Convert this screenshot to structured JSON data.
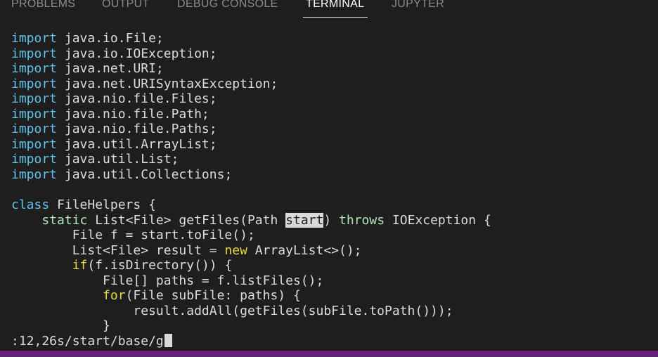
{
  "panel": {
    "tabs": [
      {
        "label": "PROBLEMS"
      },
      {
        "label": "OUTPUT"
      },
      {
        "label": "DEBUG CONSOLE"
      },
      {
        "label": "TERMINAL"
      },
      {
        "label": "JUPYTER"
      }
    ],
    "active_tab": "TERMINAL"
  },
  "editor": {
    "imports": [
      {
        "keyword": "import",
        "rest": " java.io.File;"
      },
      {
        "keyword": "import",
        "rest": " java.io.IOException;"
      },
      {
        "keyword": "import",
        "rest": " java.net.URI;"
      },
      {
        "keyword": "import",
        "rest": " java.net.URISyntaxException;"
      },
      {
        "keyword": "import",
        "rest": " java.nio.file.Files;"
      },
      {
        "keyword": "import",
        "rest": " java.nio.file.Path;"
      },
      {
        "keyword": "import",
        "rest": " java.nio.file.Paths;"
      },
      {
        "keyword": "import",
        "rest": " java.util.ArrayList;"
      },
      {
        "keyword": "import",
        "rest": " java.util.List;"
      },
      {
        "keyword": "import",
        "rest": " java.util.Collections;"
      }
    ],
    "class_line": {
      "keyword": "class",
      "rest": " FileHelpers {"
    },
    "method_line": {
      "indent": "    ",
      "keyword": "static",
      "before_match": " List<File> getFiles(Path ",
      "match": "start",
      "after_match": ") ",
      "throws": "throws",
      "end": " IOException {"
    },
    "line_file_f": "        File f = start.toFile();",
    "line_result": {
      "before": "        List<File> result = ",
      "keyword": "new",
      "after": " ArrayList<>();"
    },
    "line_if": {
      "indent": "        ",
      "keyword": "if",
      "after": "(f.isDirectory()) {"
    },
    "line_paths": "            File[] paths = f.listFiles();",
    "line_for": {
      "indent": "            ",
      "keyword": "for",
      "after": "(File subFile: paths) {"
    },
    "line_addall": "                result.addAll(getFiles(subFile.toPath()));",
    "line_close": "            }"
  },
  "command_line": {
    "text": ":12,26s/start/base/g"
  },
  "colors": {
    "background": "#1e1e1e",
    "keyword_blue": "#5fc3f0",
    "keyword_yellow": "#e3dc3c",
    "keyword_green": "#b5e6b5",
    "status_bar": "#68217a"
  }
}
